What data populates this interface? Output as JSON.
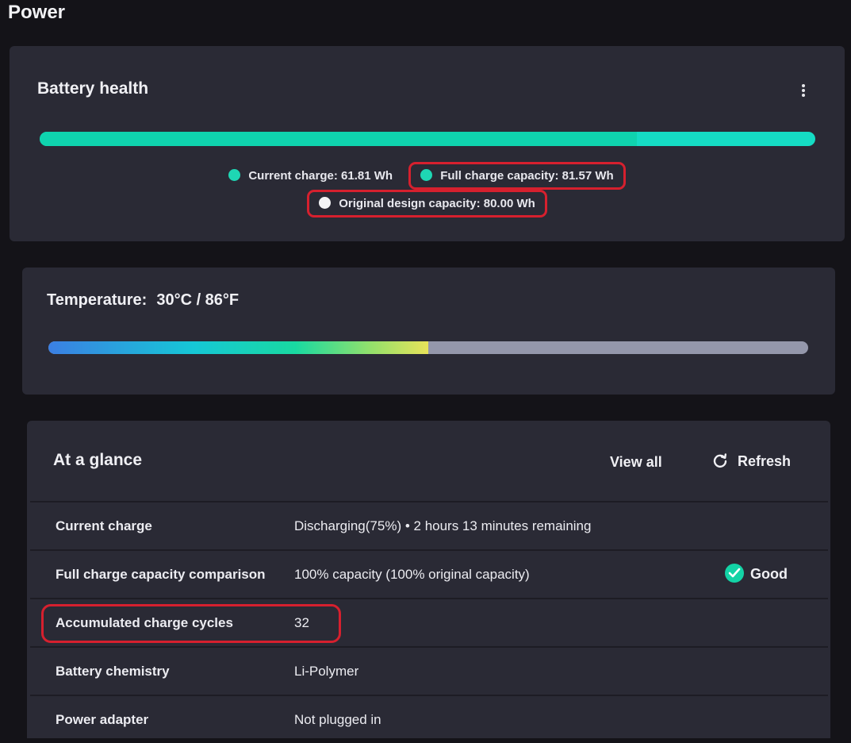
{
  "page": {
    "title": "Power"
  },
  "battery_health": {
    "title": "Battery health",
    "bar": {
      "fill_fraction": 0.77,
      "fill_color": "#0fd3ae",
      "track_color": "#15dcc4"
    },
    "legend": {
      "current_charge": "Current charge:  61.81 Wh",
      "full_charge_capacity": "Full charge capacity:  81.57 Wh",
      "original_design_capacity": "Original design capacity:  80.00 Wh"
    },
    "highlight_color": "#d6202e"
  },
  "temperature": {
    "label": "Temperature:",
    "value": "30°C / 86°F",
    "bar": {
      "fill_fraction": 0.5
    }
  },
  "at_a_glance": {
    "title": "At a glance",
    "view_all_label": "View all",
    "refresh_label": "Refresh",
    "rows": [
      {
        "label": "Current charge",
        "value": "Discharging(75%)  •  2 hours 13 minutes remaining"
      },
      {
        "label": "Full charge capacity comparison",
        "value": "100% capacity (100% original capacity)",
        "badge": "Good"
      },
      {
        "label": "Accumulated charge cycles",
        "value": "32"
      },
      {
        "label": "Battery chemistry",
        "value": "Li-Polymer"
      },
      {
        "label": "Power adapter",
        "value": "Not plugged in"
      }
    ]
  }
}
